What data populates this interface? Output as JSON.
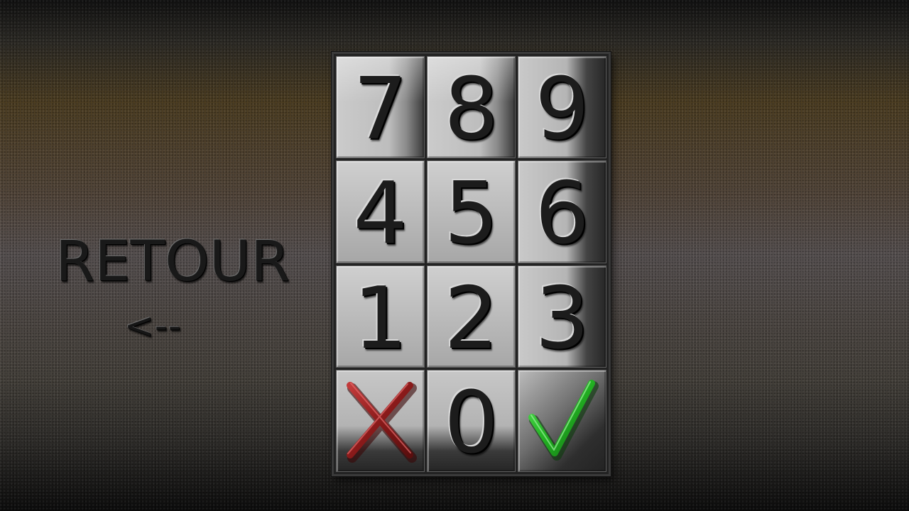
{
  "back": {
    "label": "RETOUR",
    "arrow": "<--"
  },
  "keypad": {
    "keys": [
      {
        "label": "7"
      },
      {
        "label": "8"
      },
      {
        "label": "9"
      },
      {
        "label": "4"
      },
      {
        "label": "5"
      },
      {
        "label": "6"
      },
      {
        "label": "1"
      },
      {
        "label": "2"
      },
      {
        "label": "3"
      },
      {
        "icon": "cancel-x-icon",
        "color": "#8a1a1a"
      },
      {
        "label": "0"
      },
      {
        "icon": "confirm-check-icon",
        "color": "#22b022"
      }
    ]
  }
}
